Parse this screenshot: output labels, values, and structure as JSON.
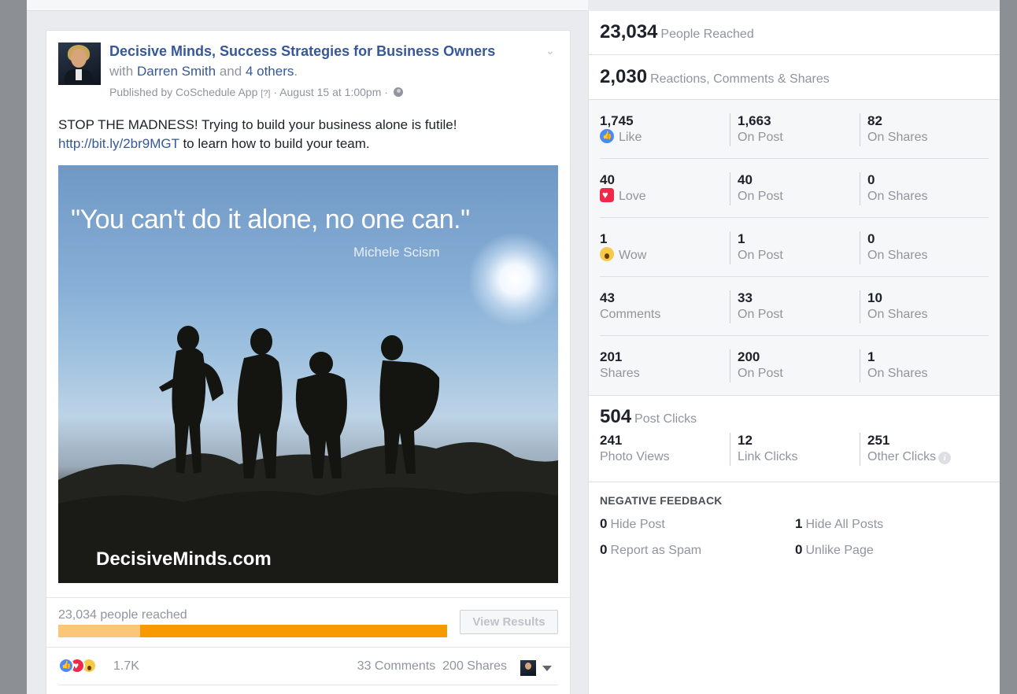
{
  "post": {
    "page_name": "Decisive Minds, Success Strategies for Business Owners",
    "with_prefix": "with",
    "with_person": "Darren Smith",
    "with_and": "and",
    "with_others": "4 others",
    "with_period": ".",
    "published_by": "Published by CoSchedule App",
    "help_mark": "[?]",
    "meta_sep": "·",
    "date": "August 15 at 1:00pm",
    "text_line1": "STOP THE MADNESS! Trying to build your business alone is futile!",
    "link": "http://bit.ly/2br9MGT",
    "text_after_link": "to learn how to build your team.",
    "photo": {
      "quote": "\"You can't do it alone, no one can.\"",
      "author": "Michele Scism",
      "watermark": "DecisiveMinds.com"
    },
    "reach_label": "23,034 people reached",
    "reach_organic_fraction": 0.21,
    "view_results": "View Results",
    "reactions_count": "1.7K",
    "comments_text": "33 Comments",
    "shares_text": "200 Shares"
  },
  "insights": {
    "people_reached": {
      "value": "23,034",
      "label": "People Reached"
    },
    "engagement": {
      "value": "2,030",
      "label": "Reactions, Comments & Shares"
    },
    "rows": [
      {
        "total": "1,745",
        "label": "Like",
        "icon": "like-icon",
        "on_post": "1,663",
        "on_post_label": "On Post",
        "on_shares": "82",
        "on_shares_label": "On Shares"
      },
      {
        "total": "40",
        "label": "Love",
        "icon": "love-icon",
        "on_post": "40",
        "on_post_label": "On Post",
        "on_shares": "0",
        "on_shares_label": "On Shares"
      },
      {
        "total": "1",
        "label": "Wow",
        "icon": "wow-icon",
        "on_post": "1",
        "on_post_label": "On Post",
        "on_shares": "0",
        "on_shares_label": "On Shares"
      },
      {
        "total": "43",
        "label": "Comments",
        "icon": "",
        "on_post": "33",
        "on_post_label": "On Post",
        "on_shares": "10",
        "on_shares_label": "On Shares"
      },
      {
        "total": "201",
        "label": "Shares",
        "icon": "",
        "on_post": "200",
        "on_post_label": "On Post",
        "on_shares": "1",
        "on_shares_label": "On Shares"
      }
    ],
    "post_clicks": {
      "value": "504",
      "label": "Post Clicks"
    },
    "clicks": [
      {
        "value": "241",
        "label": "Photo Views"
      },
      {
        "value": "12",
        "label": "Link Clicks"
      },
      {
        "value": "251",
        "label": "Other Clicks"
      }
    ],
    "negative_title": "NEGATIVE FEEDBACK",
    "negative": [
      {
        "value": "0",
        "label": "Hide Post"
      },
      {
        "value": "1",
        "label": "Hide All Posts"
      },
      {
        "value": "0",
        "label": "Report as Spam"
      },
      {
        "value": "0",
        "label": "Unlike Page"
      }
    ]
  }
}
